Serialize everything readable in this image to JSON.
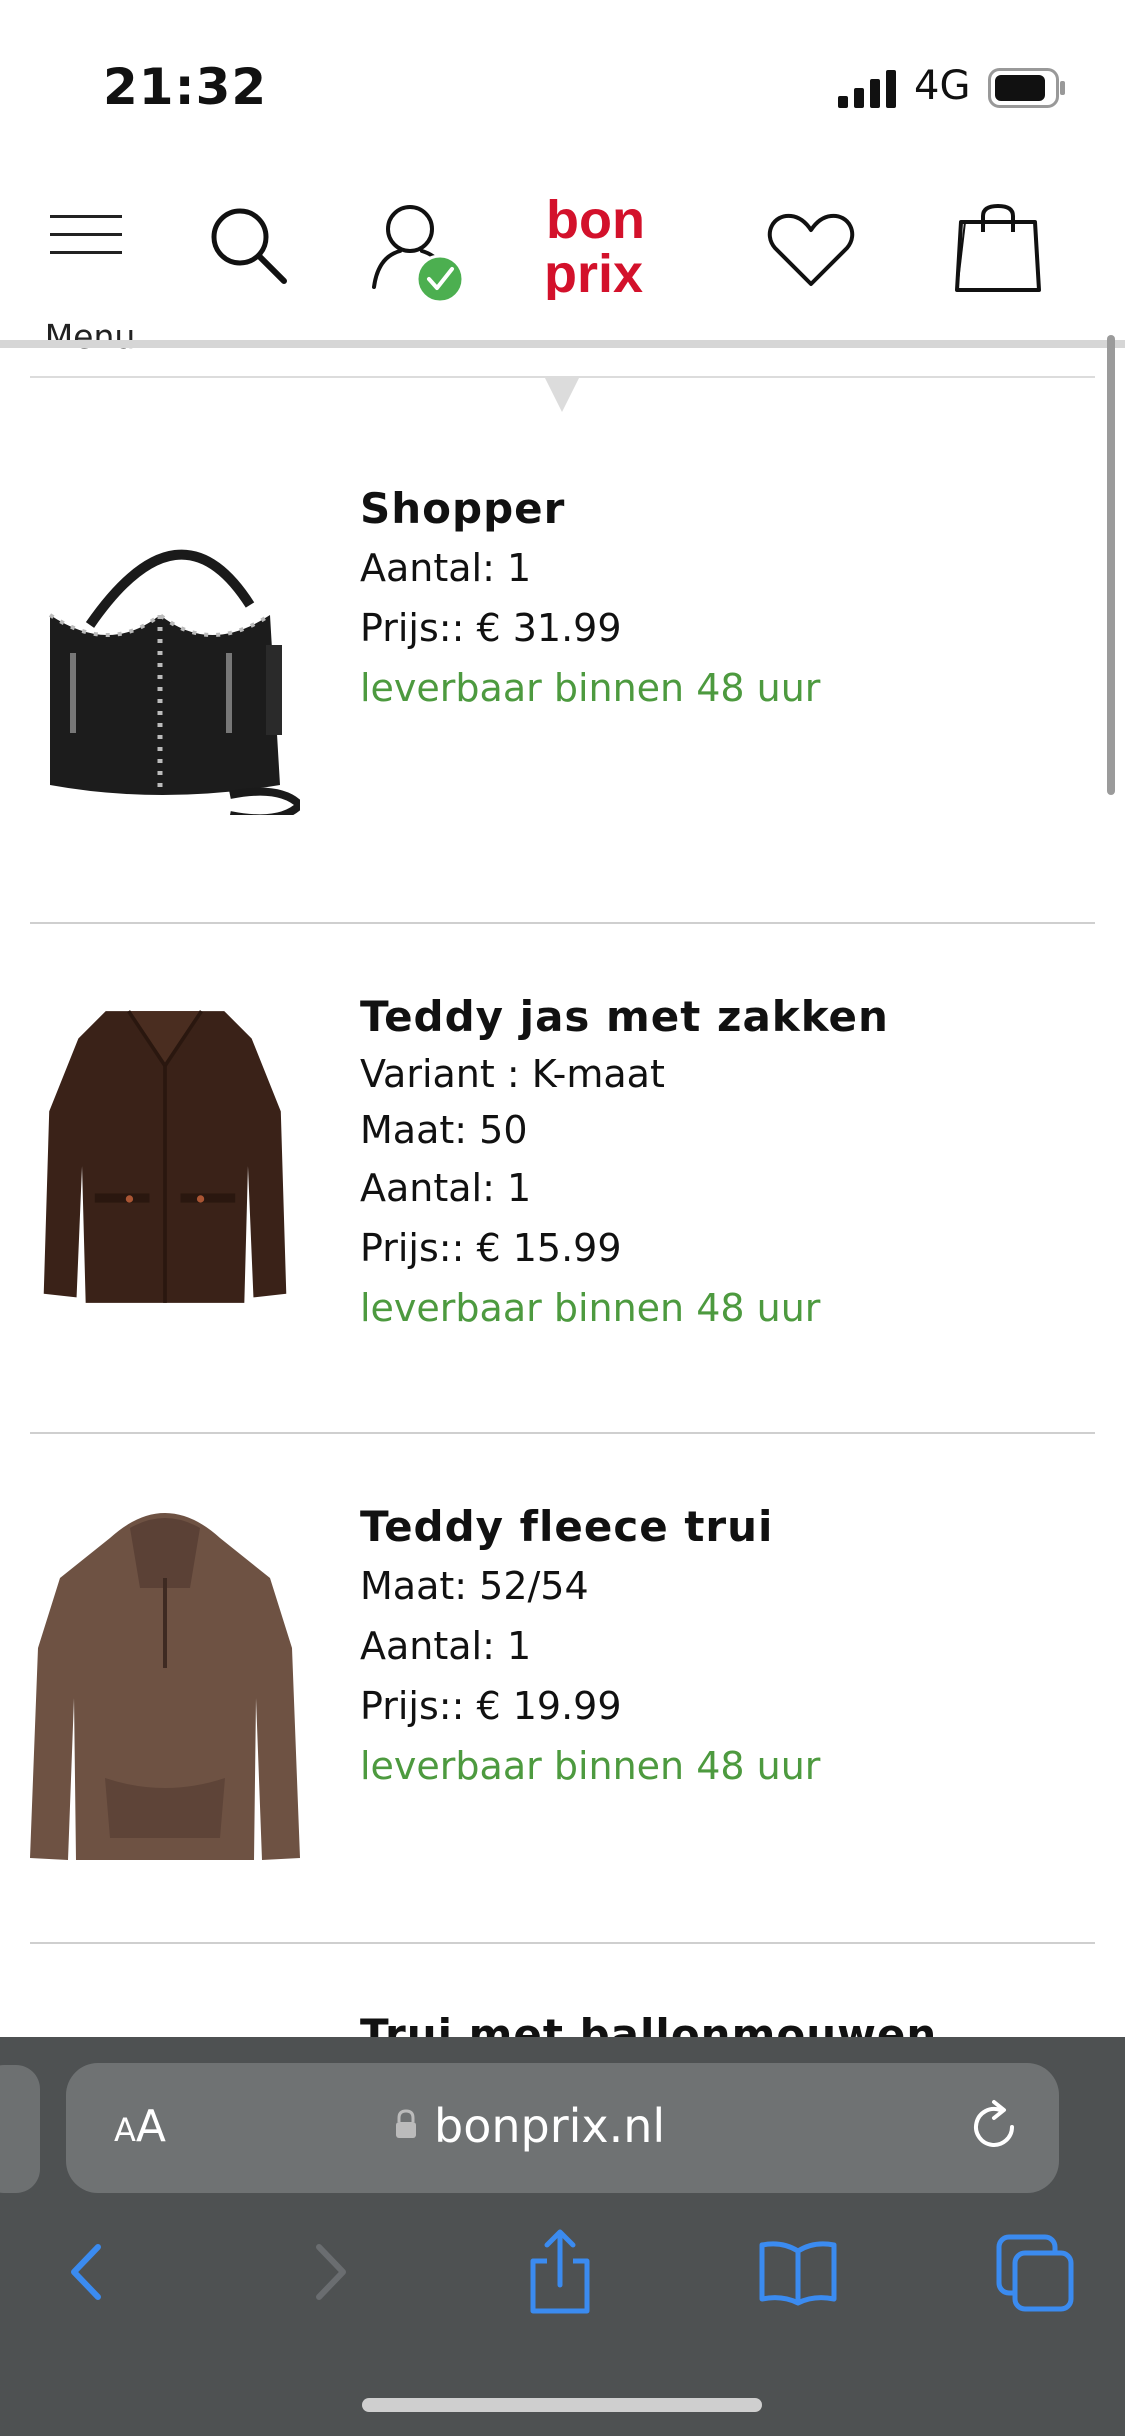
{
  "status": {
    "time": "21:32",
    "network": "4G"
  },
  "header": {
    "menu_label": "Menu",
    "logo_line1": "bon",
    "logo_line2": "prix"
  },
  "cart_items": [
    {
      "title": "Shopper",
      "lines": [
        "Aantal: 1",
        "Prijs:: € 31.99"
      ],
      "stock": "leverbaar binnen 48 uur"
    },
    {
      "title": "Teddy jas met zakken",
      "lines": [
        "Variant : K-maat",
        "Maat: 50",
        "Aantal: 1",
        "Prijs:: € 15.99"
      ],
      "stock": "leverbaar binnen 48 uur"
    },
    {
      "title": "Teddy fleece trui",
      "lines": [
        "Maat: 52/54",
        "Aantal: 1",
        "Prijs:: € 19.99"
      ],
      "stock": "leverbaar binnen 48 uur"
    },
    {
      "title": "Trui met ballonmouwen"
    }
  ],
  "browser": {
    "aa_small": "A",
    "aa_large": "A",
    "url": "bonprix.nl"
  },
  "colors": {
    "brand": "#d3112b",
    "stock_green": "#4d9a3f",
    "browser_blue": "#3b8bf0",
    "check_green": "#4caf50"
  }
}
